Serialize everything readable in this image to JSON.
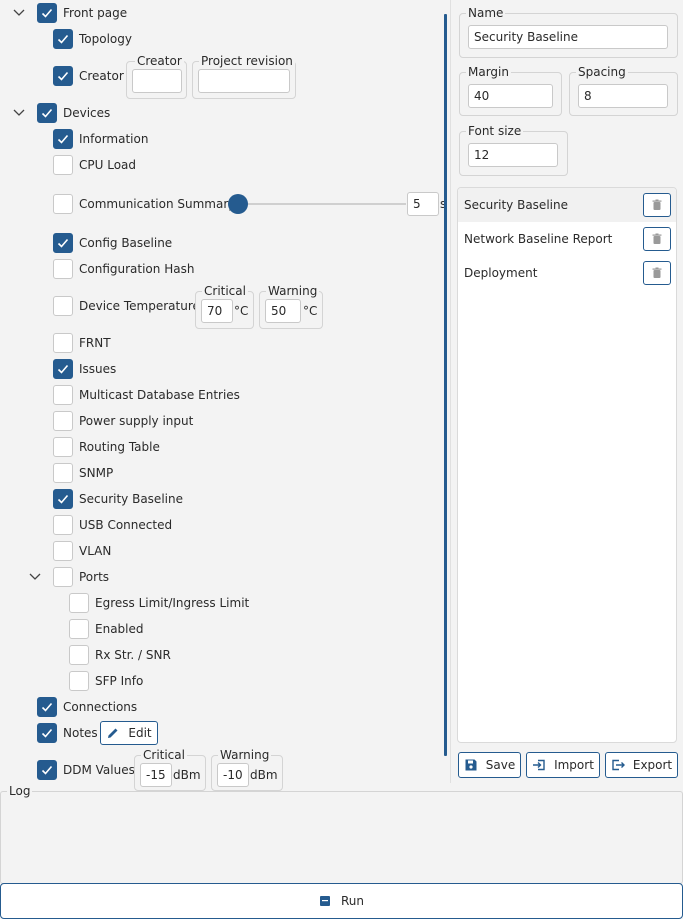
{
  "tree": {
    "front_page": {
      "label": "Front page",
      "checked": true
    },
    "topology": {
      "label": "Topology",
      "checked": true
    },
    "creator": {
      "label": "Creator",
      "checked": true,
      "creator_group": "Creator",
      "creator_value": "",
      "revision_group": "Project revision",
      "revision_value": ""
    },
    "devices": {
      "label": "Devices",
      "checked": true
    },
    "information": {
      "label": "Information",
      "checked": true
    },
    "cpu_load": {
      "label": "CPU Load",
      "checked": false
    },
    "comm_summary": {
      "label": "Communication Summary",
      "checked": false,
      "slider_value": "5",
      "unit": "s"
    },
    "config_baseline": {
      "label": "Config Baseline",
      "checked": true
    },
    "config_hash": {
      "label": "Configuration Hash",
      "checked": false
    },
    "device_temp": {
      "label": "Device Temperature",
      "checked": false,
      "critical_label": "Critical",
      "critical_value": "70",
      "warning_label": "Warning",
      "warning_value": "50",
      "unit": "°C"
    },
    "frnt": {
      "label": "FRNT",
      "checked": false
    },
    "issues": {
      "label": "Issues",
      "checked": true
    },
    "multicast": {
      "label": "Multicast Database Entries",
      "checked": false
    },
    "power_supply": {
      "label": "Power supply input",
      "checked": false
    },
    "routing_table": {
      "label": "Routing Table",
      "checked": false
    },
    "snmp": {
      "label": "SNMP",
      "checked": false
    },
    "security_baseline": {
      "label": "Security Baseline",
      "checked": true
    },
    "usb_connected": {
      "label": "USB Connected",
      "checked": false
    },
    "vlan": {
      "label": "VLAN",
      "checked": false
    },
    "ports": {
      "label": "Ports",
      "checked": false
    },
    "egress": {
      "label": "Egress Limit/Ingress Limit",
      "checked": false
    },
    "enabled": {
      "label": "Enabled",
      "checked": false
    },
    "rx_str": {
      "label": "Rx Str. / SNR",
      "checked": false
    },
    "sfp_info": {
      "label": "SFP Info",
      "checked": false
    },
    "connections": {
      "label": "Connections",
      "checked": true
    },
    "notes": {
      "label": "Notes",
      "checked": true,
      "edit_label": "Edit"
    },
    "ddm": {
      "label": "DDM Values",
      "checked": true,
      "critical_label": "Critical",
      "critical_value": "-15",
      "warning_label": "Warning",
      "warning_value": "-10",
      "unit": "dBm"
    }
  },
  "settings": {
    "name_label": "Name",
    "name_value": "Security Baseline",
    "margin_label": "Margin",
    "margin_value": "40",
    "spacing_label": "Spacing",
    "spacing_value": "8",
    "font_size_label": "Font size",
    "font_size_value": "12"
  },
  "reports": [
    {
      "name": "Security Baseline"
    },
    {
      "name": "Network Baseline Report"
    },
    {
      "name": "Deployment"
    }
  ],
  "buttons": {
    "save": "Save",
    "import": "Import",
    "export": "Export",
    "run": "Run"
  },
  "log": {
    "label": "Log"
  },
  "colors": {
    "accent": "#255b8f",
    "background": "#f3f3f3"
  }
}
